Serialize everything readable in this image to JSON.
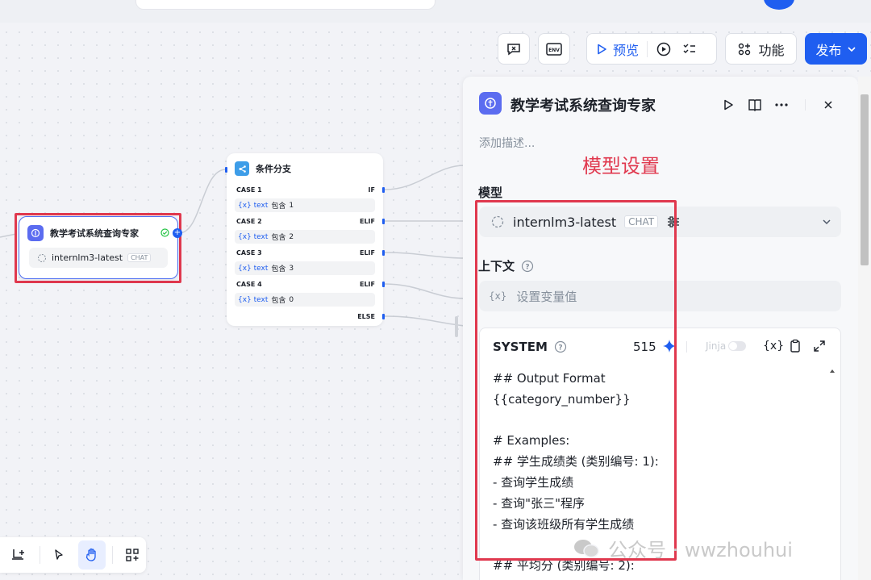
{
  "toolbar": {
    "preview_label": "预览",
    "function_label": "功能",
    "publish_label": "发布"
  },
  "llm_node": {
    "title": "教学考试系统查询专家",
    "model": "internlm3-latest",
    "model_tag": "CHAT"
  },
  "condition_node": {
    "title": "条件分支",
    "cases": [
      {
        "case": "CASE 1",
        "branch": "IF",
        "var": "{x} text",
        "op": "包含",
        "value": "1"
      },
      {
        "case": "CASE 2",
        "branch": "ELIF",
        "var": "{x} text",
        "op": "包含",
        "value": "2"
      },
      {
        "case": "CASE 3",
        "branch": "ELIF",
        "var": "{x} text",
        "op": "包含",
        "value": "3"
      },
      {
        "case": "CASE 4",
        "branch": "ELIF",
        "var": "{x} text",
        "op": "包含",
        "value": "0"
      }
    ],
    "else_label": "ELSE"
  },
  "panel": {
    "title": "教学考试系统查询专家",
    "description_placeholder": "添加描述...",
    "model_label": "模型",
    "model_value": "internlm3-latest",
    "model_tag": "CHAT",
    "context_label": "上下文",
    "context_placeholder": "设置变量值",
    "system_label": "SYSTEM",
    "token_count": "515",
    "jinja_label": "Jinja",
    "var_button": "{x}",
    "system_prompt": "## Output Format\n{{category_number}}\n\n# Examples:\n## 学生成绩类 (类别编号: 1):\n- 查询学生成绩\n- 查询\"张三\"程序\n- 查询该班级所有学生成绩\n\n## 平均分 (类别编号: 2):"
  },
  "annotation": "模型设置",
  "watermark": "公众号 · wwzhouhui",
  "colors": {
    "accent": "#1f5ef0",
    "annotation": "#e0384e",
    "node_icon": "#5b6cf0"
  }
}
